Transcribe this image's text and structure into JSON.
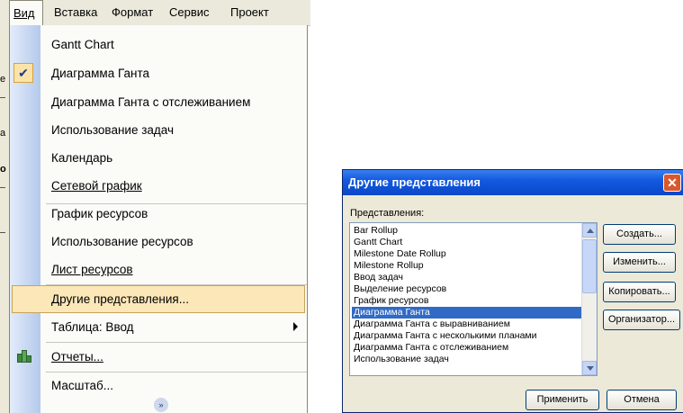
{
  "menubar": {
    "items": [
      "Вид",
      "Вставка",
      "Формат",
      "Сервис",
      "Проект"
    ]
  },
  "menu": {
    "items": [
      {
        "label": "Gantt Chart"
      },
      {
        "label": "Диаграмма Ганта",
        "checked": true
      },
      {
        "label": "Диаграмма Ганта с отслеживанием"
      },
      {
        "label": "Использование задач"
      },
      {
        "label": "Календарь"
      },
      {
        "label": "Сетевой график"
      },
      {
        "label": "График ресурсов"
      },
      {
        "label": "Использование ресурсов"
      },
      {
        "label": "Лист ресурсов"
      },
      {
        "label": "Другие представления...",
        "highlighted": true
      },
      {
        "label": "Таблица: Ввод",
        "submenu": true
      },
      {
        "label": "Отчеты..."
      },
      {
        "label": "Масштаб..."
      }
    ],
    "check_icon": "checkmark-icon",
    "report_icon": "report-icon",
    "expand_icon": "chevron-double-down-icon"
  },
  "background_fragments": {
    "a": "е",
    "b": "а",
    "c": "о"
  },
  "dialog": {
    "title": "Другие представления",
    "list_label": "Представления:",
    "list_items": [
      "Bar Rollup",
      "Gantt Chart",
      "Milestone Date Rollup",
      "Milestone Rollup",
      "Ввод задач",
      "Выделение ресурсов",
      "График ресурсов",
      "Диаграмма Ганта",
      "Диаграмма Ганта с выравниванием",
      "Диаграмма Ганта с несколькими планами",
      "Диаграмма Ганта с отслеживанием",
      "Использование задач"
    ],
    "selected_item": "Диаграмма Ганта",
    "buttons": {
      "create": "Создать...",
      "edit": "Изменить...",
      "copy": "Копировать...",
      "organizer": "Организатор...",
      "apply": "Применить",
      "cancel": "Отмена"
    },
    "close_symbol": "✕",
    "title_bar_color": "#0a48c8",
    "selection_color": "#316ac5"
  },
  "colors": {
    "menu_highlight": "#fbe7b8",
    "menu_background": "#fbfbf8",
    "icon_column": "#b4c9ec"
  }
}
